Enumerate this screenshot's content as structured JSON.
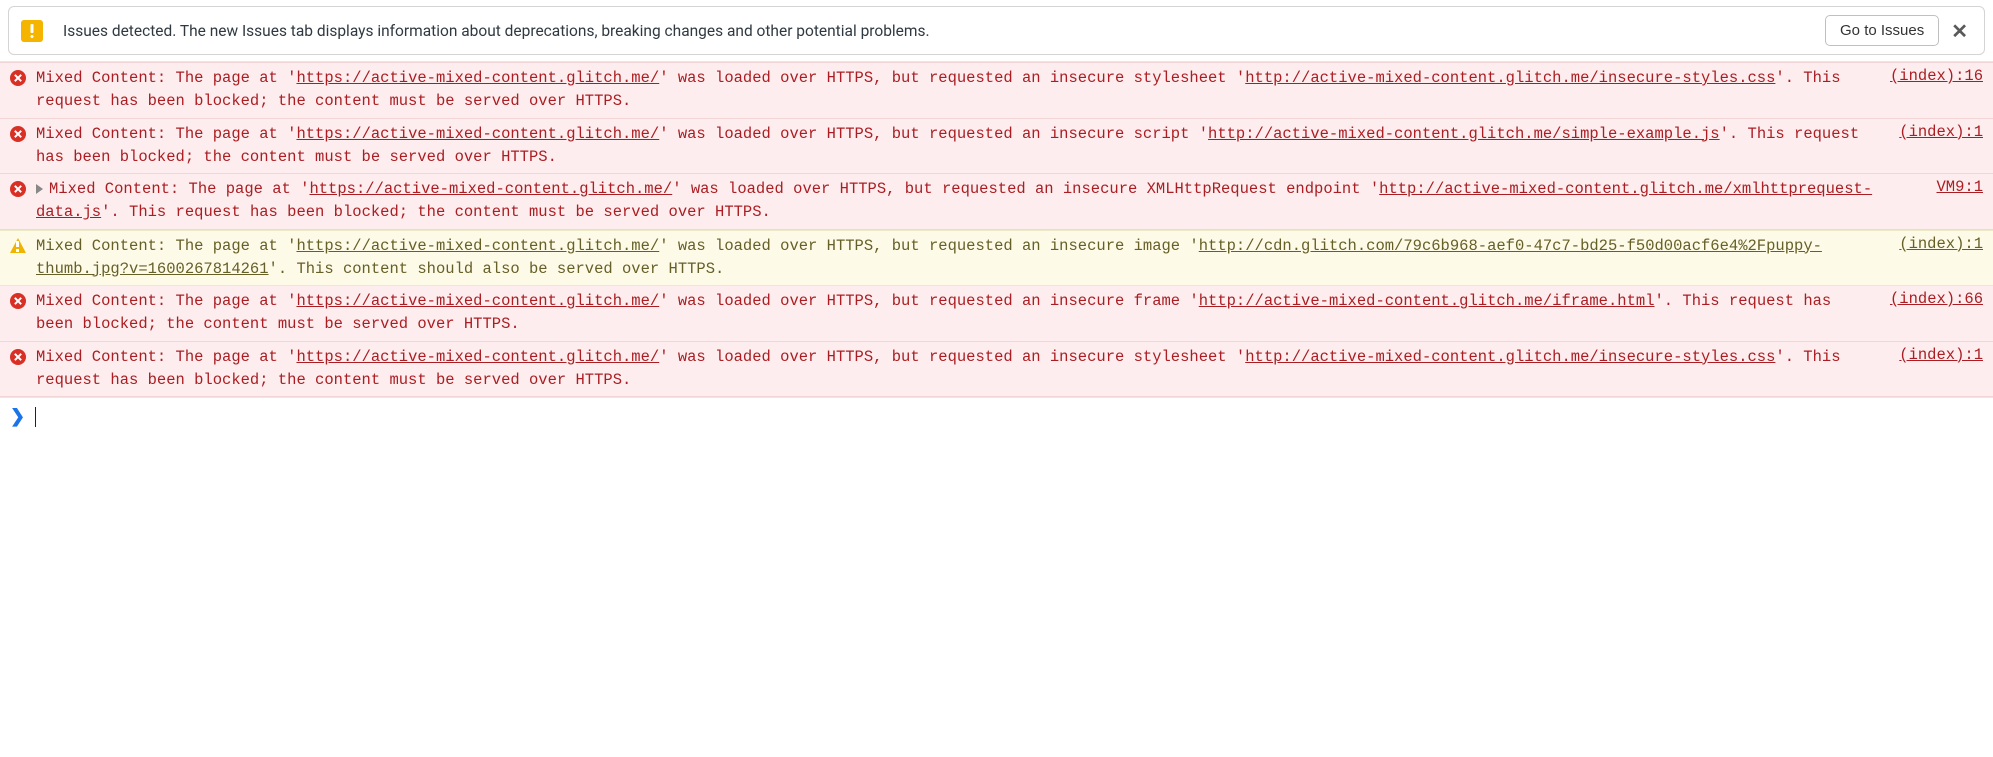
{
  "issues_bar": {
    "text": "Issues detected. The new Issues tab displays information about deprecations, breaking changes and other potential problems.",
    "button_label": "Go to Issues",
    "close_label": "✕"
  },
  "messages": [
    {
      "level": "error",
      "expandable": false,
      "source": "(index):16",
      "t1": "Mixed Content: The page at '",
      "url1": "https://active-mixed-content.glitch.me/",
      "t2": "' was loaded over HTTPS, but requested an insecure stylesheet '",
      "url2": "http://active-mixed-content.glitch.me/insecure-styles.css",
      "t3": "'. This request has been blocked; the content must be served over HTTPS."
    },
    {
      "level": "error",
      "expandable": false,
      "source": "(index):1",
      "t1": "Mixed Content: The page at '",
      "url1": "https://active-mixed-content.glitch.me/",
      "t2": "' was loaded over HTTPS, but requested an insecure script '",
      "url2": "http://active-mixed-content.glitch.me/simple-example.js",
      "t3": "'. This request has been blocked; the content must be served over HTTPS."
    },
    {
      "level": "error",
      "expandable": true,
      "source": "VM9:1",
      "t1": "Mixed Content: The page at '",
      "url1": "https://active-mixed-content.glitch.me/",
      "t2": "' was loaded over HTTPS, but requested an insecure XMLHttpRequest endpoint '",
      "url2": "http://active-mixed-content.glitch.me/xmlhttprequest-data.js",
      "t3": "'. This request has been blocked; the content must be served over HTTPS."
    },
    {
      "level": "warning",
      "expandable": false,
      "source": "(index):1",
      "t1": "Mixed Content: The page at '",
      "url1": "https://active-mixed-content.glitch.me/",
      "t2": "' was loaded over HTTPS, but requested an insecure image '",
      "url2": "http://cdn.glitch.com/79c6b968-aef0-47c7-bd25-f50d00acf6e4%2Fpuppy-thumb.jpg?v=1600267814261",
      "t3": "'. This content should also be served over HTTPS."
    },
    {
      "level": "error",
      "expandable": false,
      "source": "(index):66",
      "t1": "Mixed Content: The page at '",
      "url1": "https://active-mixed-content.glitch.me/",
      "t2": "' was loaded over HTTPS, but requested an insecure frame '",
      "url2": "http://active-mixed-content.glitch.me/iframe.html",
      "t3": "'. This request has been blocked; the content must be served over HTTPS."
    },
    {
      "level": "error",
      "expandable": false,
      "source": "(index):1",
      "t1": "Mixed Content: The page at '",
      "url1": "https://active-mixed-content.glitch.me/",
      "t2": "' was loaded over HTTPS, but requested an insecure stylesheet '",
      "url2": "http://active-mixed-content.glitch.me/insecure-styles.css",
      "t3": "'. This request has been blocked; the content must be served over HTTPS."
    }
  ],
  "prompt": {
    "caret": "❯"
  }
}
